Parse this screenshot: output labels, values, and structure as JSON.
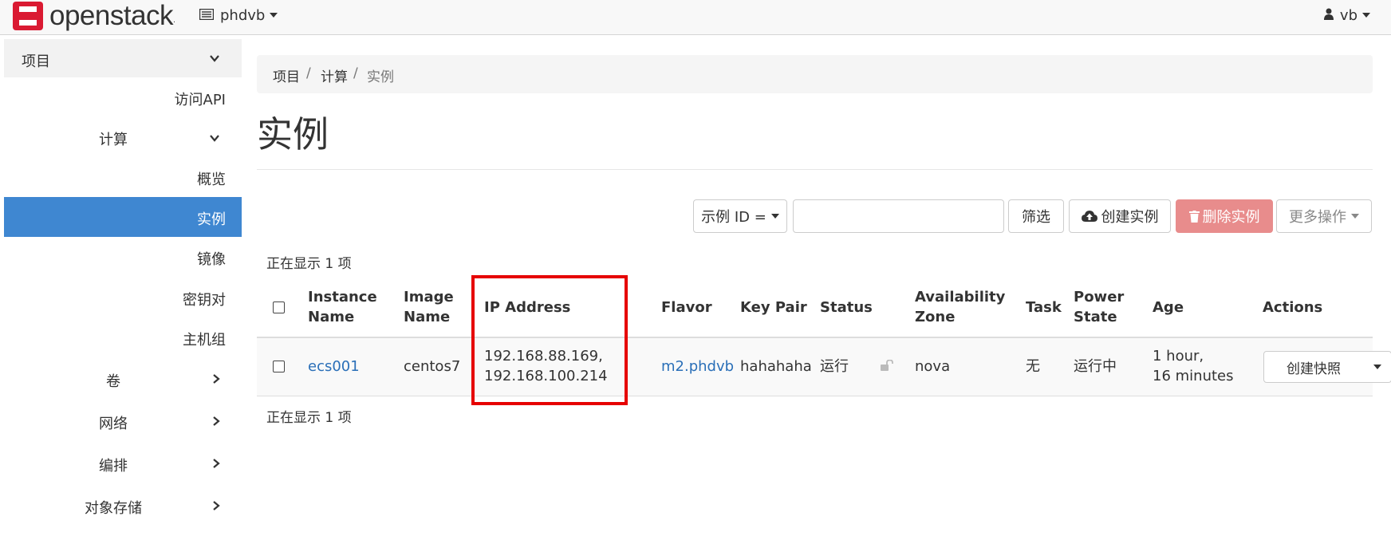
{
  "brand": {
    "name": "openstack",
    "trademark": "."
  },
  "topnav": {
    "project": "phdvb",
    "user": "vb"
  },
  "sidebar": {
    "header": "项目",
    "items": [
      {
        "label": "访问API",
        "level": 2
      },
      {
        "label": "计算",
        "level": 1,
        "expanded": true
      },
      {
        "label": "概览",
        "level": 3
      },
      {
        "label": "实例",
        "level": 3,
        "active": true
      },
      {
        "label": "镜像",
        "level": 3
      },
      {
        "label": "密钥对",
        "level": 3
      },
      {
        "label": "主机组",
        "level": 3
      },
      {
        "label": "卷",
        "level": 1
      },
      {
        "label": "网络",
        "level": 1
      },
      {
        "label": "编排",
        "level": 1
      },
      {
        "label": "对象存储",
        "level": 1
      }
    ]
  },
  "breadcrumb": [
    "项目",
    "计算",
    "实例"
  ],
  "page_title": "实例",
  "toolbar": {
    "filter_select": "示例 ID =",
    "filter_input_value": "",
    "filter_button": "筛选",
    "create_button": "创建实例",
    "delete_button": "删除实例",
    "more_button": "更多操作"
  },
  "table": {
    "count_text": "正在显示 1 项",
    "headers": {
      "instance_name": [
        "Instance",
        "Name"
      ],
      "image_name": [
        "Image",
        "Name"
      ],
      "ip_address": "IP Address",
      "flavor": "Flavor",
      "key_pair": "Key Pair",
      "status": "Status",
      "availability_zone": [
        "Availability",
        "Zone"
      ],
      "task": "Task",
      "power_state": [
        "Power",
        "State"
      ],
      "age": "Age",
      "actions": "Actions"
    },
    "rows": [
      {
        "instance_name": "ecs001",
        "image_name": "centos7",
        "ip_address": [
          "192.168.88.169,",
          "192.168.100.214"
        ],
        "flavor": "m2.phdvb",
        "key_pair": "hahahaha",
        "status": "运行",
        "availability_zone": "nova",
        "task": "无",
        "power_state": "运行中",
        "age": [
          "1 hour,",
          "16 minutes"
        ],
        "action_button": "创建快照"
      }
    ]
  },
  "colors": {
    "accent": "#3f87d1",
    "link": "#2a6fb8",
    "danger_disabled": "#e88c8c",
    "highlight": "#e60000",
    "logo_red": "#da1a32"
  }
}
